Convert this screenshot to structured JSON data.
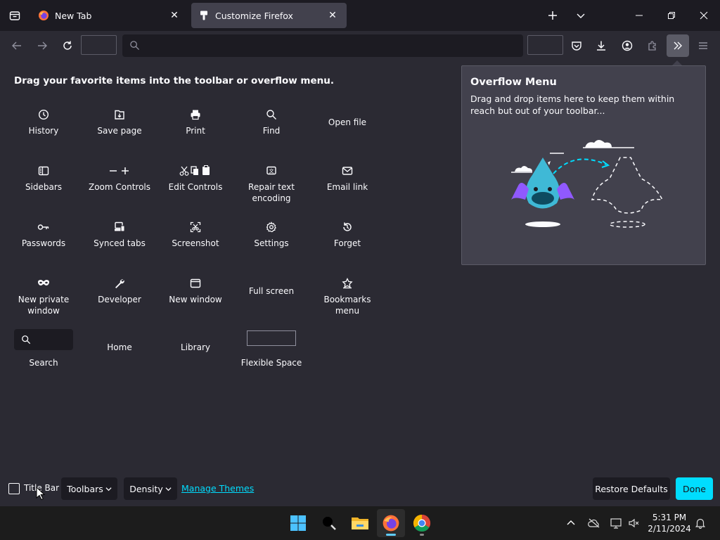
{
  "tabs": [
    {
      "title": "New Tab",
      "icon": "firefox-icon",
      "active": false
    },
    {
      "title": "Customize Firefox",
      "icon": "customize-icon",
      "active": true
    }
  ],
  "palette": {
    "title": "Drag your favorite items into the toolbar or overflow menu.",
    "items": [
      {
        "label": "History",
        "icon": "clock-icon"
      },
      {
        "label": "Save page",
        "icon": "save-page-icon"
      },
      {
        "label": "Print",
        "icon": "printer-icon"
      },
      {
        "label": "Find",
        "icon": "search-icon"
      },
      {
        "label": "Open file",
        "icon": ""
      },
      {
        "label": "Sidebars",
        "icon": "sidebar-icon"
      },
      {
        "label": "Zoom Controls",
        "icon": "zoom-icon"
      },
      {
        "label": "Edit Controls",
        "icon": "edit-controls-icon"
      },
      {
        "label": "Repair text encoding",
        "icon": "text-encoding-icon"
      },
      {
        "label": "Email link",
        "icon": "email-icon"
      },
      {
        "label": "Passwords",
        "icon": "key-icon"
      },
      {
        "label": "Synced tabs",
        "icon": "synced-tabs-icon"
      },
      {
        "label": "Screenshot",
        "icon": "screenshot-icon"
      },
      {
        "label": "Settings",
        "icon": "gear-icon"
      },
      {
        "label": "Forget",
        "icon": "forget-icon"
      },
      {
        "label": "New private window",
        "icon": "private-mask-icon"
      },
      {
        "label": "Developer",
        "icon": "wrench-icon"
      },
      {
        "label": "New window",
        "icon": "window-icon"
      },
      {
        "label": "Full screen",
        "icon": ""
      },
      {
        "label": "Bookmarks menu",
        "icon": "bookmark-star-icon"
      },
      {
        "label": "Search",
        "icon": "search-icon"
      },
      {
        "label": "Home",
        "icon": ""
      },
      {
        "label": "Library",
        "icon": ""
      },
      {
        "label": "Flexible Space",
        "icon": ""
      }
    ]
  },
  "overflow": {
    "title": "Overflow Menu",
    "description": "Drag and drop items here to keep them within reach but out of your toolbar..."
  },
  "bottom": {
    "title_bar_label": "Title Bar",
    "toolbars_label": "Toolbars",
    "density_label": "Density",
    "manage_themes_label": "Manage Themes",
    "restore_label": "Restore Defaults",
    "done_label": "Done"
  },
  "taskbar": {
    "time": "5:31 PM",
    "date": "2/11/2024"
  },
  "colors": {
    "accent": "#00ddff",
    "background": "#2b2a33",
    "panel": "#42414d",
    "tabstrip": "#1c1b22"
  }
}
